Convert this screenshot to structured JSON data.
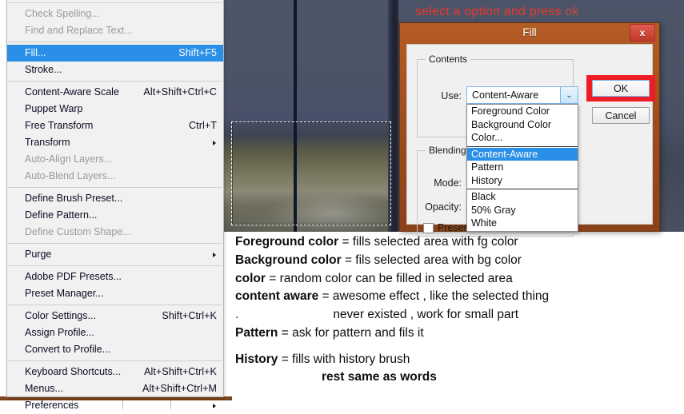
{
  "instruction": {
    "text": "select a option and press ",
    "emphasis": "ok"
  },
  "edit_menu": {
    "items": [
      {
        "label": "Check Spelling...",
        "accel": "",
        "state": "disabled",
        "submenu": false
      },
      {
        "label": "Find and Replace Text...",
        "accel": "",
        "state": "disabled",
        "submenu": false
      },
      {
        "separator": true
      },
      {
        "label": "Fill...",
        "accel": "Shift+F5",
        "state": "selected",
        "submenu": false
      },
      {
        "label": "Stroke...",
        "accel": "",
        "state": "normal",
        "submenu": false
      },
      {
        "separator": true
      },
      {
        "label": "Content-Aware Scale",
        "accel": "Alt+Shift+Ctrl+C",
        "state": "normal",
        "submenu": false
      },
      {
        "label": "Puppet Warp",
        "accel": "",
        "state": "normal",
        "submenu": false
      },
      {
        "label": "Free Transform",
        "accel": "Ctrl+T",
        "state": "normal",
        "submenu": false
      },
      {
        "label": "Transform",
        "accel": "",
        "state": "normal",
        "submenu": true
      },
      {
        "label": "Auto-Align Layers...",
        "accel": "",
        "state": "disabled",
        "submenu": false
      },
      {
        "label": "Auto-Blend Layers...",
        "accel": "",
        "state": "disabled",
        "submenu": false
      },
      {
        "separator": true
      },
      {
        "label": "Define Brush Preset...",
        "accel": "",
        "state": "normal",
        "submenu": false
      },
      {
        "label": "Define Pattern...",
        "accel": "",
        "state": "normal",
        "submenu": false
      },
      {
        "label": "Define Custom Shape...",
        "accel": "",
        "state": "disabled",
        "submenu": false
      },
      {
        "separator": true
      },
      {
        "label": "Purge",
        "accel": "",
        "state": "normal",
        "submenu": true
      },
      {
        "separator": true
      },
      {
        "label": "Adobe PDF Presets...",
        "accel": "",
        "state": "normal",
        "submenu": false
      },
      {
        "label": "Preset Manager...",
        "accel": "",
        "state": "normal",
        "submenu": false
      },
      {
        "separator": true
      },
      {
        "label": "Color Settings...",
        "accel": "Shift+Ctrl+K",
        "state": "normal",
        "submenu": false
      },
      {
        "label": "Assign Profile...",
        "accel": "",
        "state": "normal",
        "submenu": false
      },
      {
        "label": "Convert to Profile...",
        "accel": "",
        "state": "normal",
        "submenu": false
      },
      {
        "separator": true
      },
      {
        "label": "Keyboard Shortcuts...",
        "accel": "Alt+Shift+Ctrl+K",
        "state": "normal",
        "submenu": false
      },
      {
        "label": "Menus...",
        "accel": "Alt+Shift+Ctrl+M",
        "state": "normal",
        "submenu": false
      },
      {
        "label": "Preferences",
        "accel": "",
        "state": "normal",
        "submenu": true
      }
    ]
  },
  "fill_dialog": {
    "title": "Fill",
    "close_glyph": "x",
    "contents_group_label": "Contents",
    "use_label": "Use:",
    "use_value": "Content-Aware",
    "caret_glyph": "⌄",
    "use_options": [
      {
        "label": "Foreground Color",
        "selected": false
      },
      {
        "label": "Background Color",
        "selected": false
      },
      {
        "label": "Color...",
        "selected": false
      },
      {
        "separator": true
      },
      {
        "label": "Content-Aware",
        "selected": true
      },
      {
        "label": "Pattern",
        "selected": false
      },
      {
        "label": "History",
        "selected": false
      },
      {
        "separator": true
      },
      {
        "label": "Black",
        "selected": false
      },
      {
        "label": "50% Gray",
        "selected": false
      },
      {
        "label": "White",
        "selected": false
      }
    ],
    "blending_group_label": "Blending",
    "mode_label": "Mode:",
    "opacity_label": "Opacity:",
    "preserve_label": "Preserve",
    "ok_label": "OK",
    "cancel_label": "Cancel",
    "highlight_color": "#ee1c25"
  },
  "annotations": {
    "lines": [
      {
        "term": "Foreground  color",
        "rest": " = fills selected area with fg color"
      },
      {
        "term": "Background color",
        "rest": " = fils selected area with bg color"
      },
      {
        "term": "color",
        "rest": " = random color can be filled in selected area"
      },
      {
        "term": "content aware",
        "rest": " = awesome effect , like the selected thing"
      },
      {
        "term": ".",
        "rest": "never existed , work for small part",
        "indented": true
      },
      {
        "term": "Pattern",
        "rest": " = ask for pattern and fils it"
      },
      {
        "term": "History",
        "rest": " = fills with history brush"
      },
      {
        "term": "rest same as words",
        "rest": "",
        "indented": true,
        "bold_all": true
      }
    ]
  }
}
